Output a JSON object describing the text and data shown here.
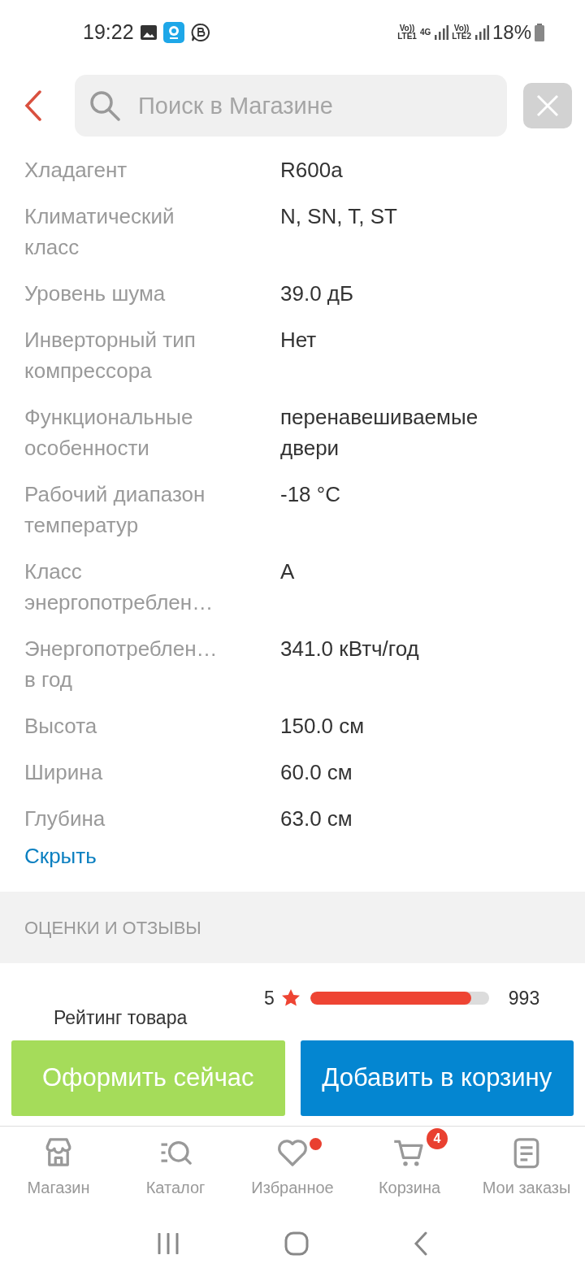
{
  "status_bar": {
    "time": "19:22",
    "sim1": {
      "top": "Vo))",
      "bottom": "LTE1"
    },
    "network": "4G",
    "sim2": {
      "top": "Vo))",
      "bottom": "LTE2"
    },
    "battery": "18%"
  },
  "search": {
    "placeholder": "Поиск в Магазине"
  },
  "specs": [
    {
      "label": "Хладагент",
      "value": "R600a"
    },
    {
      "label": "Климатический класс",
      "value": "N, SN, T, ST"
    },
    {
      "label": "Уровень шума",
      "value": "39.0 дБ"
    },
    {
      "label": "Инверторный тип компрессора",
      "value": "Нет"
    },
    {
      "label": "Функциональные особенности",
      "value": "перенавешиваемые двери"
    },
    {
      "label": "Рабочий диапазон температур",
      "value": "-18 °C"
    },
    {
      "label": "Класс энергопотреблен…",
      "value": "A"
    },
    {
      "label": "Энергопотреблен… в год",
      "value": "341.0 кВтч/год"
    },
    {
      "label": "Высота",
      "value": "150.0 см"
    },
    {
      "label": "Ширина",
      "value": "60.0 см"
    },
    {
      "label": "Глубина",
      "value": "63.0 см"
    }
  ],
  "hide_link": "Скрыть",
  "reviews": {
    "heading": "ОЦЕНКИ И ОТЗЫВЫ",
    "rating_label": "Рейтинг товара",
    "rows": [
      {
        "stars_label": "5",
        "level": 0.9,
        "count": "993"
      }
    ]
  },
  "actions": [
    {
      "kind": "buy",
      "label": "Оформить сейчас"
    },
    {
      "kind": "cart",
      "label": "Добавить в корзину"
    }
  ],
  "tabs": [
    {
      "kind": "shop",
      "label": "Магазин",
      "selected": false
    },
    {
      "kind": "catalog",
      "label": "Каталог",
      "selected": false
    },
    {
      "kind": "favorites",
      "label": "Избранное",
      "selected": false,
      "dot": true
    },
    {
      "kind": "cart",
      "label": "Корзина",
      "selected": false,
      "badge": "4"
    },
    {
      "kind": "orders",
      "label": "Мои заказы",
      "selected": false
    }
  ]
}
